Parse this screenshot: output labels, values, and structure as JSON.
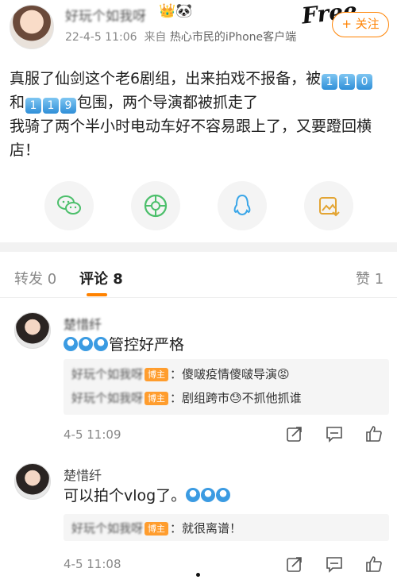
{
  "post": {
    "username": "好玩个如我呀",
    "badges": "👑🐼",
    "time": "22-4-5 11:06",
    "source_prefix": "来自",
    "source": "热心市民的iPhone客户端",
    "watermark": "Free",
    "follow_label": "+ 关注",
    "text": {
      "line1_a": "真服了仙剑这个老6剧组，出来拍戏不报备，被",
      "line1_keys": [
        "1",
        "1",
        "0"
      ],
      "line2_a": "和",
      "line2_keys": [
        "1",
        "1",
        "9"
      ],
      "line2_b": "包围，两个导演都被抓走了",
      "line3": "我骑了两个半小时电动车好不容易跟上了，又要蹬回横",
      "line4": "店！"
    }
  },
  "share_icons": [
    "wechat-icon",
    "moments-icon",
    "qq-icon",
    "save-image-icon"
  ],
  "tabs": {
    "repost": "转发 0",
    "comments": "评论 8",
    "likes": "赞 1"
  },
  "comments": [
    {
      "name": "楚惜纤",
      "text": "管控好严格",
      "replies": [
        {
          "name": "好玩个如我呀",
          "tag": "博主",
          "text": "：傻啵疫情傻啵导演😡"
        },
        {
          "name": "好玩个如我呀",
          "tag": "博主",
          "text": "：剧组跨市😓不抓他抓谁"
        }
      ],
      "time": "4-5 11:09"
    },
    {
      "name": "楚惜纤",
      "text": "可以拍个vlog了。",
      "replies": [
        {
          "name": "好玩个如我呀",
          "tag": "博主",
          "text": "：就很离谱！"
        }
      ],
      "time": "4-5 11:08"
    }
  ],
  "colors": {
    "accent": "#ff8200",
    "tag": "#ff9d2e",
    "keycap": "#2f8fd8",
    "share_green": "#4cbf6b"
  }
}
